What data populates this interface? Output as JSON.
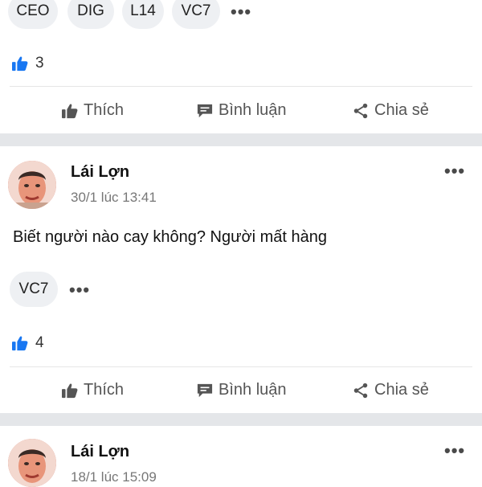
{
  "post1": {
    "tags": [
      "CEO",
      "DIG",
      "L14",
      "VC7"
    ],
    "more_tags": "•••",
    "likes": "3",
    "actions": {
      "like": "Thích",
      "comment": "Bình luận",
      "share": "Chia sẻ"
    }
  },
  "post2": {
    "author": "Lái Lợn",
    "time": "30/1 lúc 13:41",
    "content": "Biết người nào cay không? Người mất hàng",
    "tags": [
      "VC7"
    ],
    "more_tags": "•••",
    "menu": "•••",
    "likes": "4",
    "actions": {
      "like": "Thích",
      "comment": "Bình luận",
      "share": "Chia sẻ"
    }
  },
  "post3": {
    "author": "Lái Lợn",
    "time": "18/1 lúc 15:09",
    "menu": "•••"
  },
  "colors": {
    "accent": "#1877f2",
    "separator": "#e4e6e9",
    "chip": "#eef0f3"
  },
  "icons": [
    "thumbs-up-icon",
    "comment-icon",
    "share-icon",
    "more-icon"
  ]
}
